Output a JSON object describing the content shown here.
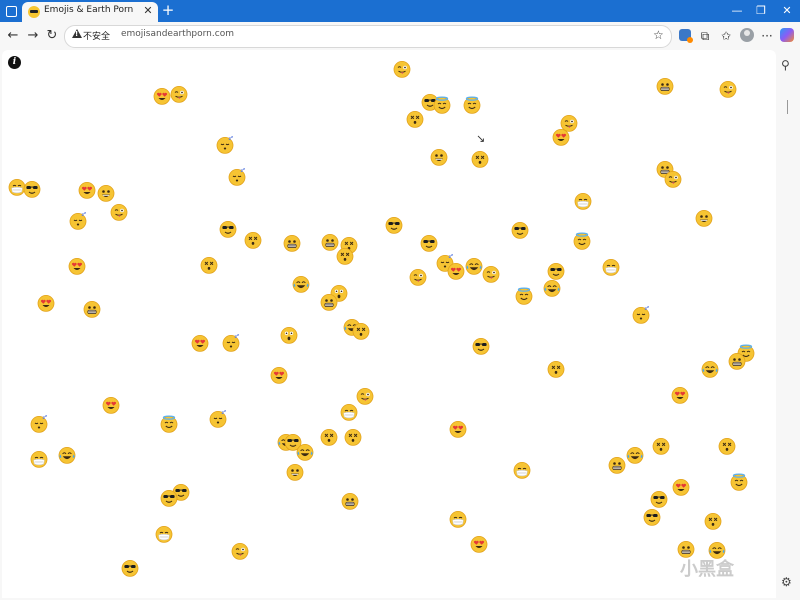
{
  "browser": {
    "tab": {
      "title": "Emojis & Earth Porn",
      "close_glyph": "✕"
    },
    "new_tab_glyph": "+",
    "window": {
      "minimize_glyph": "—",
      "maximize_glyph": "❐",
      "close_glyph": "✕"
    },
    "nav": {
      "back_glyph": "←",
      "forward_glyph": "→",
      "reload_glyph": "↻"
    },
    "address": {
      "security_label": "不安全",
      "url": "emojisandearthporn.com"
    },
    "toolbar_glyphs": {
      "star": "☆",
      "frame": "⧉",
      "favorites": "✩",
      "more": "···"
    },
    "sidebar": {
      "search_glyph": "⚲",
      "settings_glyph": "⚙"
    },
    "watermark": "小黑盒"
  },
  "page": {
    "info_label": "i",
    "cursor_glyph": "↘",
    "emoji_kinds": {
      "heart-eyes": "smiling face with heart-shaped eyes",
      "tongue-wink": "winking face with tongue",
      "sunglasses": "smiling face with sunglasses",
      "halo": "smiling face with halo",
      "astonished": "astonished face",
      "dizzy": "dizzy face",
      "grin": "grinning face",
      "grimace": "grimacing face",
      "sleeping": "sleeping face",
      "mask": "face with medical mask",
      "tears-of-joy": "face with tears of joy"
    }
  }
}
